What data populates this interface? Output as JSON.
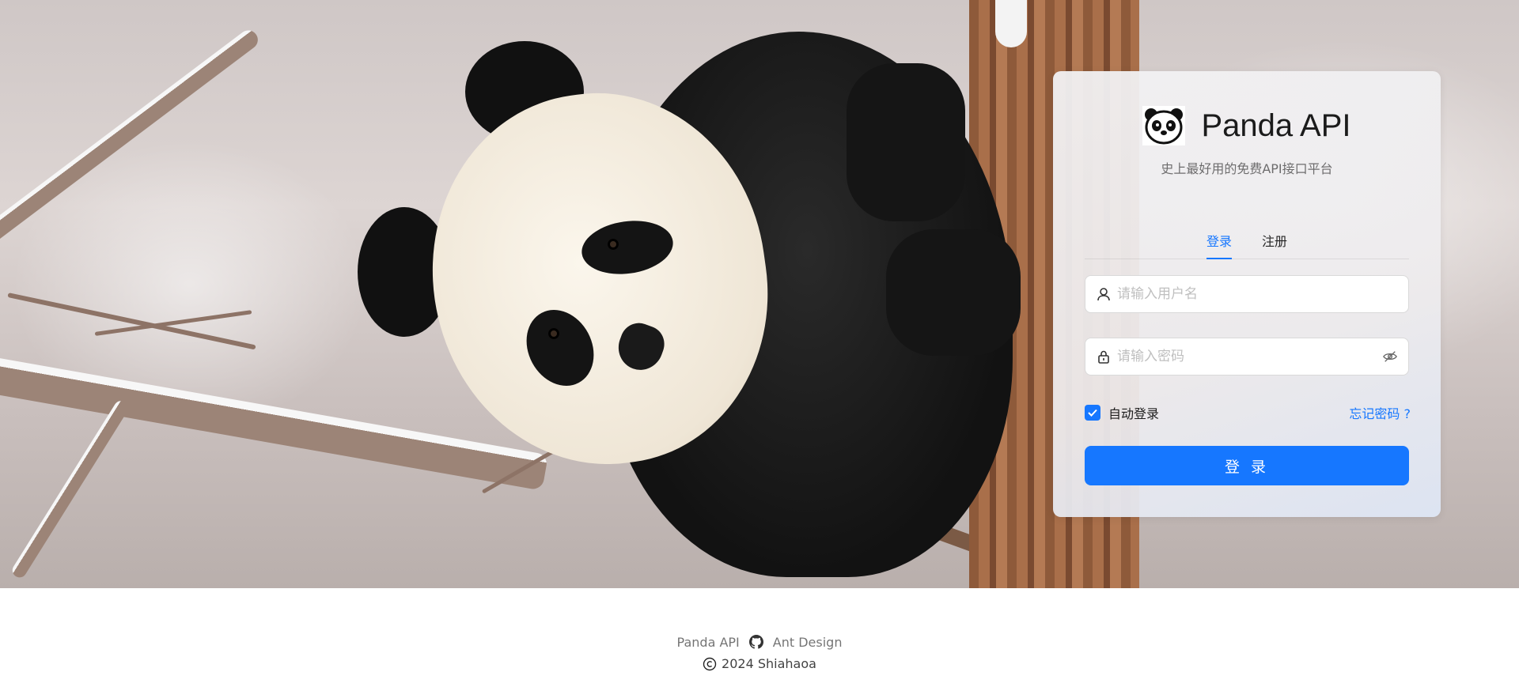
{
  "brand": {
    "title": "Panda API",
    "subtitle": "史上最好用的免费API接口平台"
  },
  "tabs": [
    {
      "label": "登录",
      "active": true
    },
    {
      "label": "注册",
      "active": false
    }
  ],
  "form": {
    "username_placeholder": "请输入用户名",
    "password_placeholder": "请输入密码",
    "remember_label": "自动登录",
    "remember_checked": true,
    "forgot_label": "忘记密码 ?",
    "submit_label": "登 录"
  },
  "footer": {
    "link1": "Panda API",
    "link2": "Ant Design",
    "copyright": "2024 Shiahaoa",
    "github_icon": "github-icon",
    "copyright_icon": "copyright-icon"
  },
  "colors": {
    "primary": "#1677ff",
    "text_secondary": "rgba(0,0,0,0.55)"
  }
}
